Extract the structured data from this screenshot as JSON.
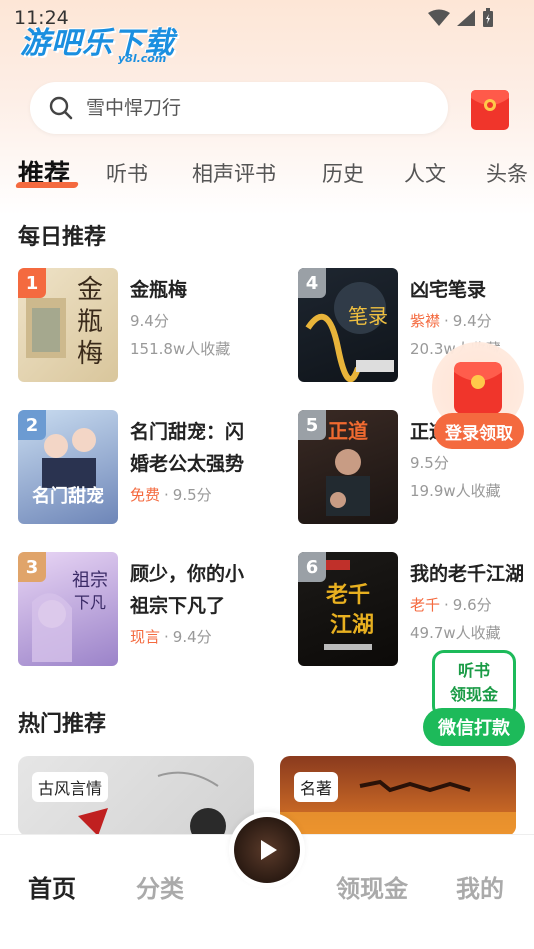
{
  "status_bar": {
    "time": "11:24"
  },
  "app": {
    "logo_text": "游吧乐下载",
    "logo_sub": "y8l.com"
  },
  "search": {
    "placeholder": "雪中悍刀行"
  },
  "tabs": [
    {
      "label": "推荐",
      "active": true
    },
    {
      "label": "听书"
    },
    {
      "label": "相声评书"
    },
    {
      "label": "历史"
    },
    {
      "label": "人文"
    },
    {
      "label": "头条"
    }
  ],
  "daily": {
    "title": "每日推荐",
    "books": [
      {
        "rank": "1",
        "title": "金瓶梅",
        "tag": "",
        "score": "9.4分",
        "favorites": "151.8w人收藏",
        "rank_color": "#f46a3f"
      },
      {
        "rank": "4",
        "title": "凶宅笔录",
        "tag": "紫襟",
        "score": "9.4分",
        "favorites": "20.3w人收藏",
        "rank_color": "#9aa0a6"
      },
      {
        "rank": "2",
        "title": "名门甜宠：闪婚老公太强势",
        "tag": "免费",
        "score": "9.5分",
        "favorites": "",
        "rank_color": "#6c9bd2"
      },
      {
        "rank": "5",
        "title": "正道",
        "tag": "",
        "score": "9.5分",
        "favorites": "19.9w人收藏",
        "rank_color": "#9aa0a6"
      },
      {
        "rank": "3",
        "title": "顾少，你的小祖宗下凡了",
        "tag": "现言",
        "score": "9.4分",
        "favorites": "",
        "rank_color": "#e0a46a"
      },
      {
        "rank": "6",
        "title": "我的老千江湖",
        "tag": "老千",
        "score": "9.6分",
        "favorites": "49.7w人收藏",
        "rank_color": "#9aa0a6"
      }
    ]
  },
  "float_red": {
    "label": "登录领取"
  },
  "wechat_float": {
    "line1": "听书",
    "line2": "领现金",
    "button": "微信打款"
  },
  "hot": {
    "title": "热门推荐",
    "cards": [
      {
        "tag": "古风言情"
      },
      {
        "tag": "名著"
      }
    ]
  },
  "bottom_nav": [
    {
      "label": "首页",
      "active": true
    },
    {
      "label": "分类"
    },
    {
      "label": "领现金"
    },
    {
      "label": "我的"
    }
  ],
  "colors": {
    "accent": "#f46a3f",
    "wechat_green": "#1dba5a",
    "bg_peach": "#fde6d6"
  }
}
